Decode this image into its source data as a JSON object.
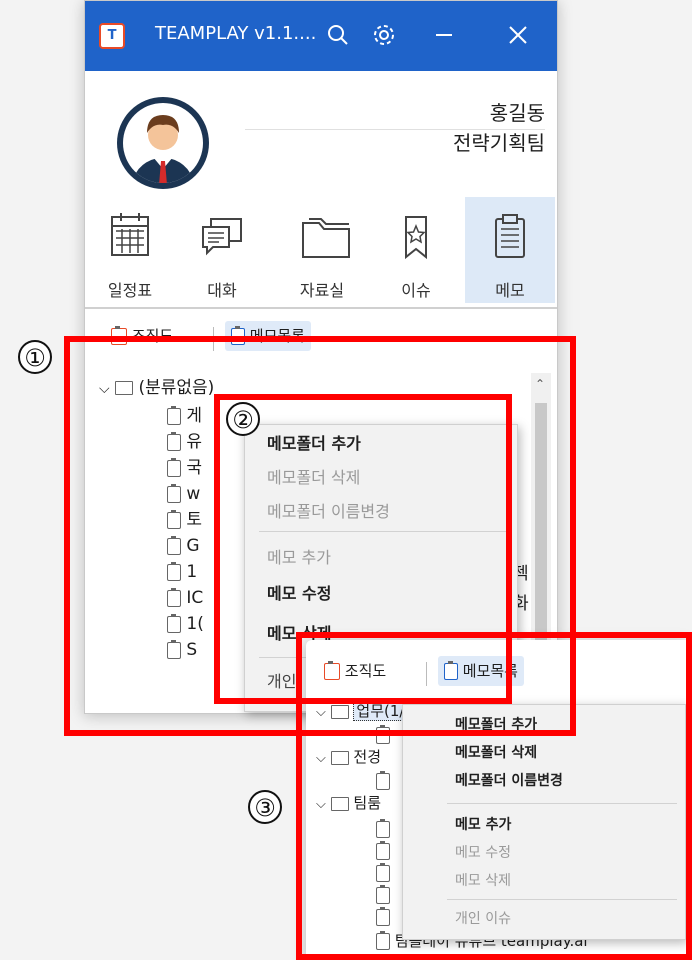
{
  "app": {
    "title": "TEAMPLAY v1.1....",
    "logo_letter": "T",
    "user": {
      "name": "홍길동",
      "team": "전략기획팀"
    },
    "menu": [
      {
        "label": "일정표",
        "icon": "calendar-icon"
      },
      {
        "label": "대화",
        "icon": "chat-icon"
      },
      {
        "label": "자료실",
        "icon": "folder-icon"
      },
      {
        "label": "이슈",
        "icon": "bookmark-star-icon"
      },
      {
        "label": "메모",
        "icon": "clipboard-icon",
        "active": true
      }
    ],
    "tabs": {
      "org": "조직도",
      "memo_list": "메모목록"
    },
    "tree": {
      "folder": "(분류없음)",
      "items": [
        "게",
        "유",
        "국",
        "w",
        "토",
        "G",
        "1",
        "IC",
        "1(",
        "S"
      ],
      "side_fragments": [
        "젝",
        "화"
      ]
    }
  },
  "context_menu_2": {
    "items": [
      {
        "label": "메모폴더 추가",
        "enabled": true
      },
      {
        "label": "메모폴더 삭제",
        "enabled": false
      },
      {
        "label": "메모폴더 이름변경",
        "enabled": false
      },
      {
        "label": "메모 추가",
        "enabled": false
      },
      {
        "label": "메모 수정",
        "enabled": true
      },
      {
        "label": "메모 삭제",
        "enabled": true
      },
      {
        "label": "개인",
        "enabled": true
      }
    ]
  },
  "zoom": {
    "tabs": {
      "org": "조직도",
      "memo_list": "메모목록"
    },
    "folders": [
      "업무",
      "전경",
      "팀룸"
    ],
    "selected_folder_suffix": "(1/3)",
    "bottom_text": "팀플레이 유튜브 teamplay.ai",
    "side_fragments": [
      "f",
      "e"
    ],
    "context_menu": [
      {
        "label": "메모폴더 추가",
        "enabled": true
      },
      {
        "label": "메모폴더 삭제",
        "enabled": true
      },
      {
        "label": "메모폴더 이름변경",
        "enabled": true
      },
      {
        "label": "메모 추가",
        "enabled": true
      },
      {
        "label": "메모 수정",
        "enabled": false
      },
      {
        "label": "메모 삭제",
        "enabled": false
      },
      {
        "label": "개인 이슈",
        "enabled": false
      }
    ]
  },
  "markers": [
    "①",
    "②",
    "③"
  ],
  "colors": {
    "titlebar": "#1f63c9",
    "highlight": "#ff0000",
    "selection": "#dfeaf8"
  }
}
